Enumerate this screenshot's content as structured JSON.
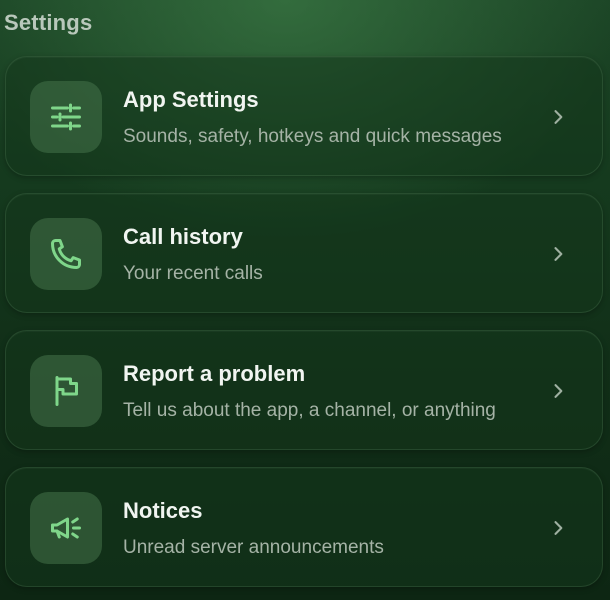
{
  "header": {
    "title": "Settings"
  },
  "colors": {
    "accent": "#7fd68a",
    "background": "#153a1e"
  },
  "items": [
    {
      "title": "App Settings",
      "subtitle": "Sounds, safety, hotkeys and quick messages",
      "icon": "sliders-icon"
    },
    {
      "title": "Call history",
      "subtitle": "Your recent calls",
      "icon": "phone-icon"
    },
    {
      "title": "Report a problem",
      "subtitle": "Tell us about the app, a channel, or anything",
      "icon": "flag-icon"
    },
    {
      "title": "Notices",
      "subtitle": "Unread server announcements",
      "icon": "megaphone-icon"
    }
  ]
}
